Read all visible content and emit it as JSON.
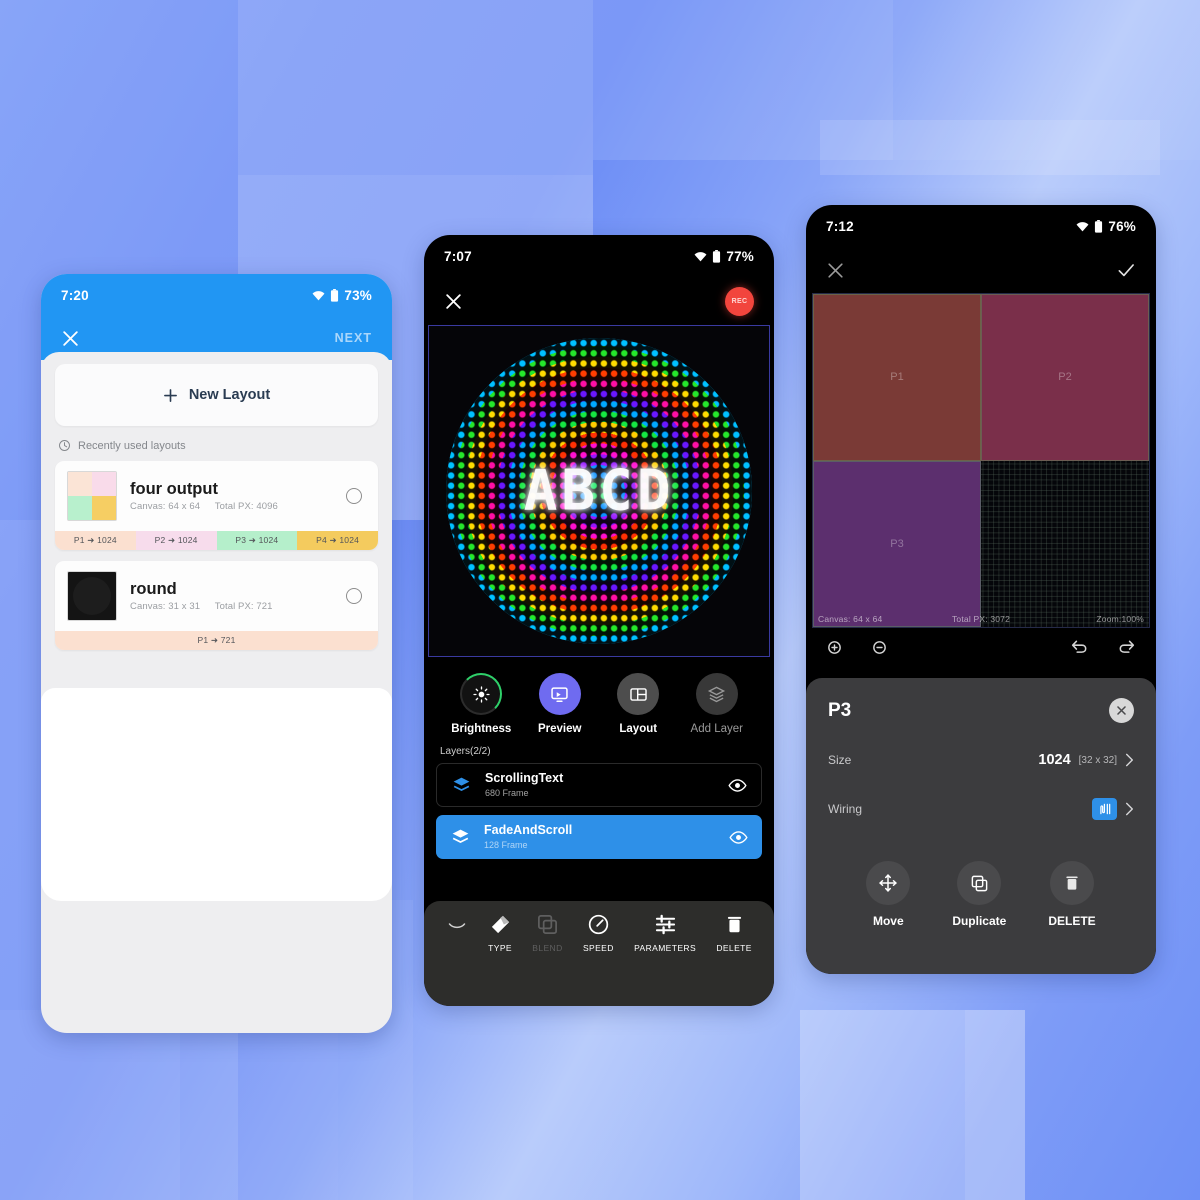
{
  "phone1": {
    "status": {
      "time": "7:20",
      "battery": "73%",
      "wifi_icon": "wifi-icon",
      "battery_icon": "battery-icon"
    },
    "appbar": {
      "close_icon": "close-icon",
      "next_label": "NEXT"
    },
    "new_layout": {
      "label": "New Layout",
      "icon": "plus-icon"
    },
    "recent": {
      "label": "Recently used layouts",
      "icon": "clock-icon"
    },
    "layouts": [
      {
        "name": "four output",
        "canvas": "Canvas: 64 x 64",
        "total_px": "Total PX: 4096",
        "thumb_colors": [
          "#fbe4d6",
          "#f9dbea",
          "#b8f0cd",
          "#f6ce63"
        ],
        "ports": [
          {
            "label": "P1 ➜ 1024",
            "color": "#fbe0d0"
          },
          {
            "label": "P2 ➜ 1024",
            "color": "#f7dcec"
          },
          {
            "label": "P3 ➜ 1024",
            "color": "#b5efcb"
          },
          {
            "label": "P4 ➜ 1024",
            "color": "#f4cb5e"
          }
        ]
      },
      {
        "name": "round",
        "canvas": "Canvas: 31 x 31",
        "total_px": "Total PX: 721",
        "thumb_colors": [
          "#141414",
          "#141414",
          "#141414",
          "#141414"
        ],
        "ports": [
          {
            "label": "P1 ➜ 721",
            "color": "#fbe0d0"
          }
        ]
      }
    ]
  },
  "phone2": {
    "status": {
      "time": "7:07",
      "battery": "77%",
      "wifi_icon": "wifi-icon",
      "battery_icon": "battery-icon"
    },
    "appbar": {
      "close_icon": "close-icon",
      "rec_label": "REC"
    },
    "preview": {
      "text": "ABCD",
      "name": "led-preview"
    },
    "tools": [
      {
        "label": "Brightness",
        "icon": "brightness-icon",
        "active": true
      },
      {
        "label": "Preview",
        "icon": "preview-icon",
        "active": true
      },
      {
        "label": "Layout",
        "icon": "layout-icon",
        "active": true
      },
      {
        "label": "Add Layer",
        "icon": "add-layer-icon",
        "active": false
      }
    ],
    "layers_title": "Layers(2/2)",
    "layers": [
      {
        "name": "ScrollingText",
        "frames": "680 Frame",
        "selected": false,
        "eye_icon": "eye-icon"
      },
      {
        "name": "FadeAndScroll",
        "frames": "128 Frame",
        "selected": true,
        "eye_icon": "eye-icon"
      }
    ],
    "bottom_toolbar": {
      "collapse_icon": "chevron-down-icon",
      "items": [
        {
          "label": "TYPE",
          "icon": "type-icon",
          "enabled": true
        },
        {
          "label": "BLEND",
          "icon": "blend-icon",
          "enabled": false
        },
        {
          "label": "SPEED",
          "icon": "speed-icon",
          "enabled": true
        },
        {
          "label": "PARAMETERS",
          "icon": "parameters-icon",
          "enabled": true
        },
        {
          "label": "DELETE",
          "icon": "trash-icon",
          "enabled": true
        }
      ]
    }
  },
  "phone3": {
    "status": {
      "time": "7:12",
      "battery": "76%",
      "wifi_icon": "wifi-icon",
      "battery_icon": "battery-icon"
    },
    "appbar": {
      "close_icon": "close-icon",
      "confirm_icon": "check-icon"
    },
    "canvas": {
      "panels": [
        {
          "label": "P1",
          "color": "#7a3a36"
        },
        {
          "label": "P2",
          "color": "#7a2f4a"
        },
        {
          "label": "P3",
          "color": "#5c2f6e"
        }
      ],
      "status_left": "Canvas: 64 x 64",
      "status_center": "Total PX: 3072",
      "status_right": "Zoom:100%"
    },
    "icon_row": {
      "zoom_in": "zoom-in-icon",
      "zoom_out": "zoom-out-icon",
      "undo": "undo-icon",
      "redo": "redo-icon"
    },
    "sheet": {
      "title": "P3",
      "close_icon": "close-icon",
      "size_label": "Size",
      "size_value": "1024",
      "size_dim": "[32 x 32]",
      "wiring_label": "Wiring",
      "wiring_icon": "wiring-icon",
      "actions": [
        {
          "label": "Move",
          "icon": "move-icon"
        },
        {
          "label": "Duplicate",
          "icon": "duplicate-icon"
        },
        {
          "label": "DELETE",
          "icon": "trash-icon"
        }
      ]
    }
  },
  "theme": {
    "accent_blue": "#2196f3",
    "preview_purple": "#6f6bf0",
    "rec_red": "#f2453d",
    "layer_selected": "#2e90e8",
    "sheet_bg": "#3c3c3e"
  }
}
